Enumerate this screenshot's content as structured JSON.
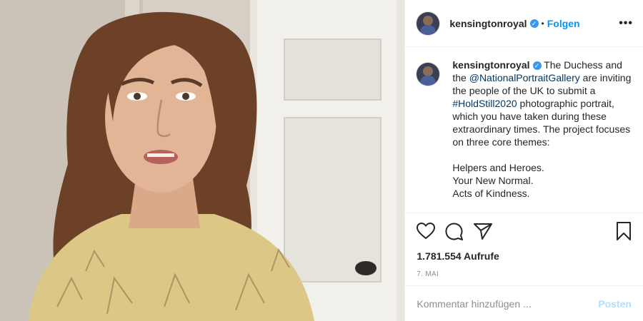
{
  "header": {
    "username": "kensingtonroyal",
    "verified_icon": "verified-badge-icon",
    "separator": "•",
    "follow_label": "Folgen",
    "more_label": "•••"
  },
  "caption": {
    "username": "kensingtonroyal",
    "text_1": "The Duchess and the ",
    "mention": "@NationalPortraitGallery",
    "text_2": " are inviting the people of the UK to submit a ",
    "hashtag": "#HoldStill2020",
    "text_3": " photographic portrait, which you have taken during these extraordinary times. The project focuses on three core themes:",
    "themes": [
      "Helpers and Heroes.",
      "Your New Normal.",
      "Acts of Kindness."
    ]
  },
  "actions": {
    "like_icon": "heart-icon",
    "comment_icon": "comment-icon",
    "share_icon": "paper-plane-icon",
    "save_icon": "bookmark-icon",
    "views": "1.781.554 Aufrufe",
    "date": "7. MAI"
  },
  "comment_box": {
    "placeholder": "Kommentar hinzufügen ...",
    "post_label": "Posten"
  },
  "colors": {
    "link": "#0095f6",
    "verified": "#3897f0",
    "muted": "#8e8e8e",
    "post_disabled": "#b2dffc"
  }
}
